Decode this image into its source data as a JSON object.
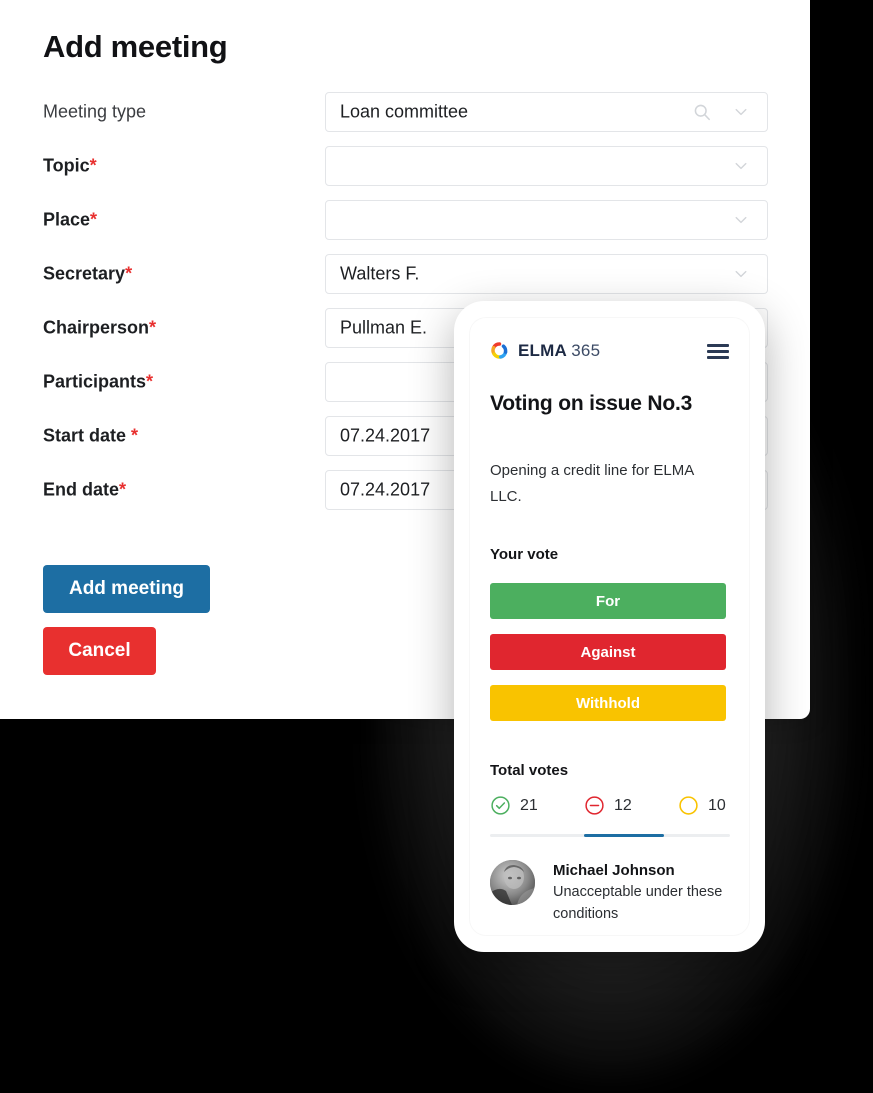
{
  "form": {
    "title": "Add meeting",
    "fields": [
      {
        "label": "Meeting type",
        "required": false,
        "value": "Loan committee",
        "search_icon": "search-icon",
        "chevron_icon": "chevron-down-icon"
      },
      {
        "label": "Topic",
        "required": true,
        "value": "",
        "chevron_icon": "chevron-down-icon"
      },
      {
        "label": "Place",
        "required": true,
        "value": "",
        "chevron_icon": "chevron-down-icon"
      },
      {
        "label": "Secretary",
        "required": true,
        "value": "Walters F.",
        "chevron_icon": "chevron-down-icon"
      },
      {
        "label": "Chairperson",
        "required": true,
        "value": "Pullman E.",
        "chevron_icon": "chevron-down-icon"
      },
      {
        "label": "Participants",
        "required": true,
        "value": "",
        "chevron_icon": "chevron-down-icon"
      },
      {
        "label": "Start date ",
        "required": true,
        "value": "07.24.2017",
        "chevron_icon": "chevron-down-icon"
      },
      {
        "label": "End date",
        "required": true,
        "value": "07.24.2017",
        "chevron_icon": "chevron-down-icon"
      }
    ],
    "required_marker": "*",
    "submit_label": "Add meeting",
    "cancel_label": "Cancel",
    "colors": {
      "submit": "#1d6ea3",
      "cancel": "#e8302f",
      "required": "#e8302f"
    }
  },
  "phone": {
    "brand": {
      "name": "ELMA",
      "suffix": "365",
      "logo_icon": "elma-logo-icon"
    },
    "menu_icon": "hamburger-menu-icon",
    "title": "Voting on issue No.3",
    "description": "Opening a credit line for ELMA LLC.",
    "vote_section_label": "Your vote",
    "vote_buttons": [
      {
        "label": "For",
        "color": "#4caf5f"
      },
      {
        "label": "Against",
        "color": "#e0262f"
      },
      {
        "label": "Withhold",
        "color": "#f9c300"
      }
    ],
    "total_section_label": "Total votes",
    "tally": [
      {
        "icon": "check-circle-icon",
        "count": "21",
        "color": "#4caf5f"
      },
      {
        "icon": "minus-circle-icon",
        "count": "12",
        "color": "#e0262f"
      },
      {
        "icon": "empty-circle-icon",
        "count": "10",
        "color": "#f9c300"
      }
    ],
    "progress_color": "#1d6ea3",
    "comment": {
      "author": "Michael Johnson",
      "text": "Unacceptable under these conditions",
      "avatar_icon": "user-photo-avatar"
    }
  }
}
